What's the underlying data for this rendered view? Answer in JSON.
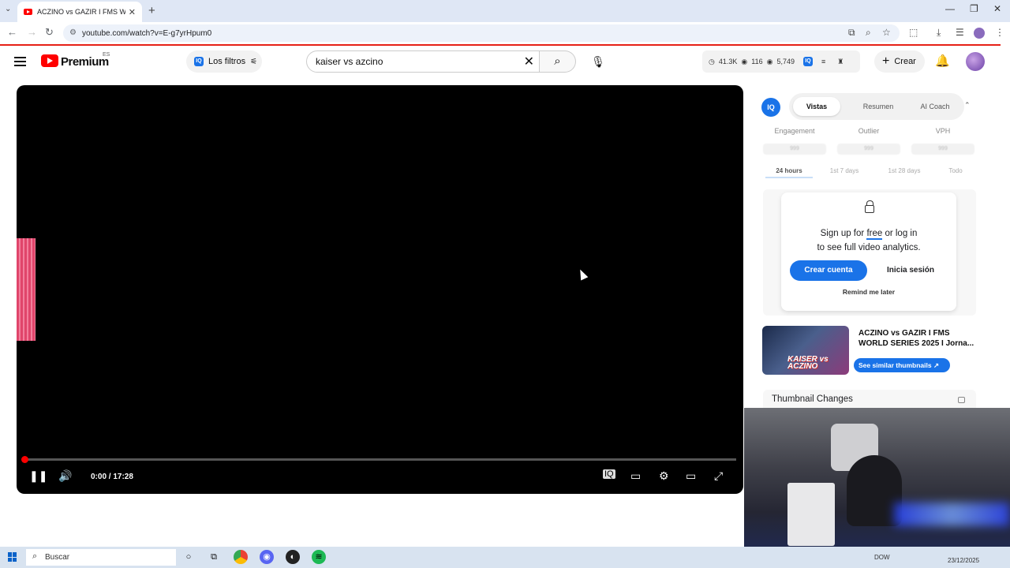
{
  "browser": {
    "tab_title": "ACZINO vs GAZIR I FMS WORLD",
    "url": "youtube.com/watch?v=E-g7yrHpum0"
  },
  "youtube": {
    "logo_text": "Premium",
    "region": "ES",
    "filters_label": "Los filtros",
    "search_value": "kaiser vs azcino",
    "stats": {
      "views": "41.3K",
      "watching": "116",
      "likes": "5,749"
    },
    "create_label": "Crear"
  },
  "player": {
    "time": "0:00 / 17:28",
    "progress_fraction": 0.0
  },
  "panel": {
    "tabs": [
      "Vistas",
      "Resumen",
      "AI Coach"
    ],
    "active_tab": "Vistas",
    "metrics": [
      "Engagement",
      "Outlier",
      "VPH"
    ],
    "metric_values": [
      "999",
      "999",
      "999"
    ],
    "ranges": [
      "24 hours",
      "1st 7 days",
      "1st 28 days",
      "Todo"
    ],
    "signup_line1_a": "Sign up for ",
    "signup_free": "free",
    "signup_line1_b": " or log in",
    "signup_line2": "to see full video analytics.",
    "create_account": "Crear cuenta",
    "login": "Inicia sesión",
    "remind": "Remind me later",
    "video_title": "ACZINO vs GAZIR I FMS WORLD SERIES 2025 I Jorna...",
    "thumb_text": "KAISER vs ACZINO",
    "similar_btn": "See similar thumbnails ↗",
    "thumbnail_changes": "Thumbnail Changes"
  },
  "taskbar": {
    "search": "Buscar",
    "dow": "DOW",
    "date": "23/12/2025"
  },
  "colors": {
    "accent": "#1a73e8",
    "youtube_red": "#ff0000"
  },
  "icons": [
    "menu-icon",
    "youtube-logo-icon",
    "search-icon",
    "mic-icon",
    "bell-icon",
    "pause-icon",
    "volume-icon",
    "subtitles-icon",
    "settings-icon",
    "theater-icon",
    "fullscreen-icon",
    "lock-icon"
  ]
}
